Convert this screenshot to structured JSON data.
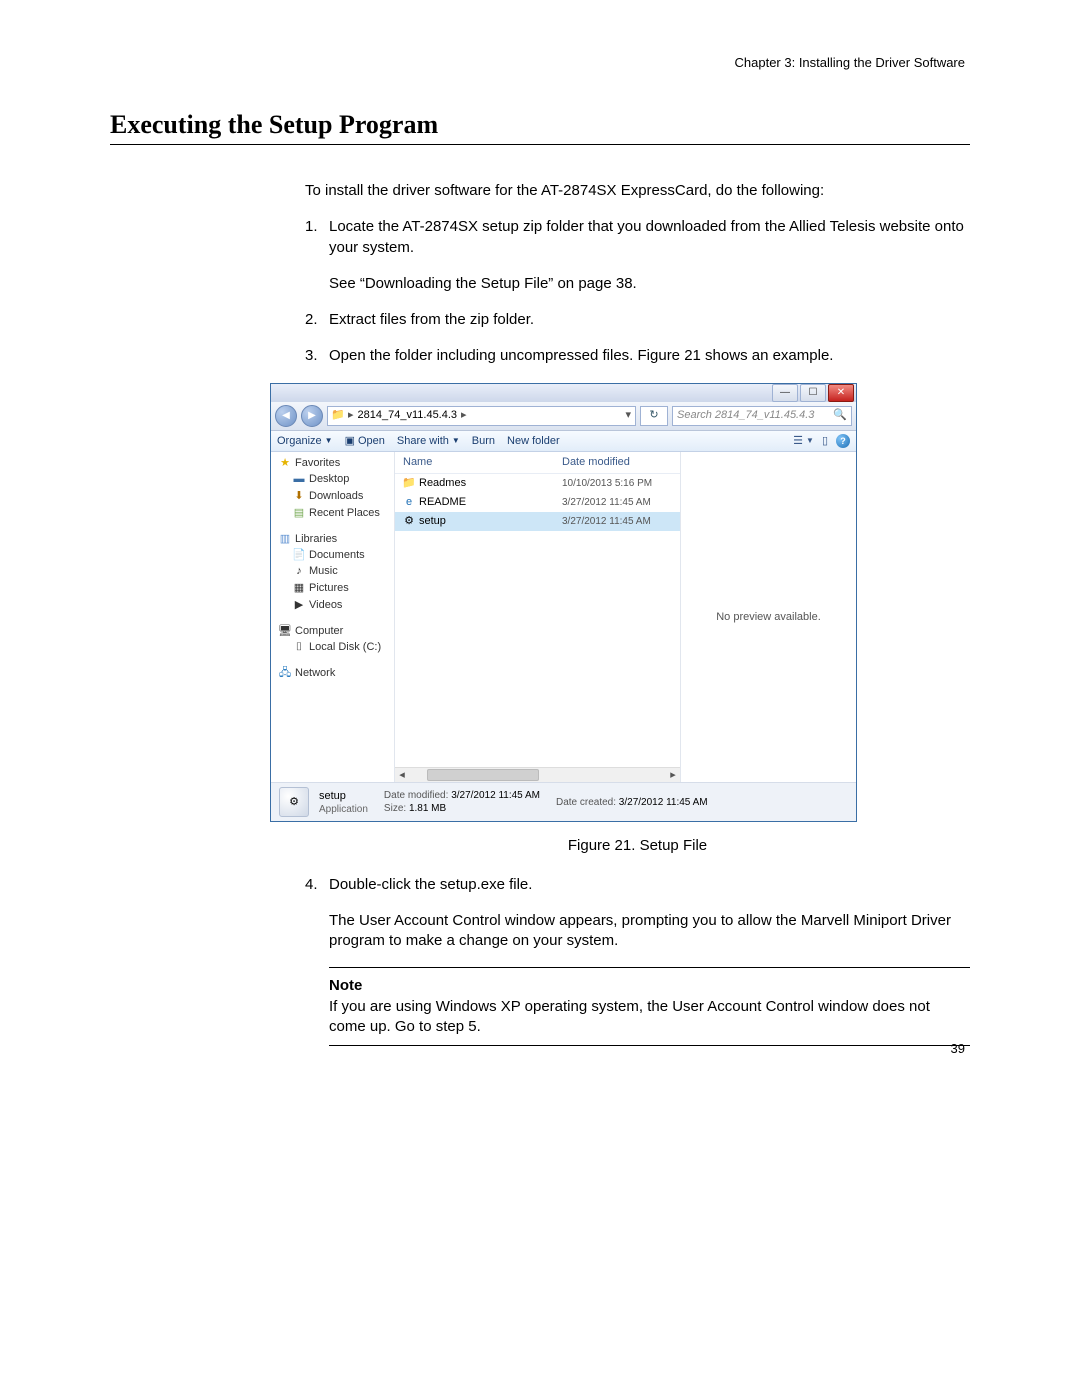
{
  "chapter": "Chapter 3: Installing the Driver Software",
  "heading": "Executing the Setup Program",
  "intro": "To install the driver software for the AT-2874SX ExpressCard, do the following:",
  "steps": {
    "s1_num": "1.",
    "s1_txt": "Locate the AT-2874SX setup zip folder that you downloaded from the Allied Telesis website onto your system.",
    "s1_sub": "See “Downloading the Setup File” on page 38.",
    "s2_num": "2.",
    "s2_txt": "Extract files from the zip folder.",
    "s3_num": "3.",
    "s3_txt": "Open the folder including uncompressed files. Figure 21 shows an example.",
    "s4_num": "4.",
    "s4_txt": "Double-click the setup.exe file.",
    "s4_sub": "The User Account Control window appears, prompting you to allow the Marvell Miniport Driver program to make a change on your system."
  },
  "figure_caption": "Figure 21. Setup File",
  "note": {
    "title": "Note",
    "body": "If you are using Windows XP operating system, the User Account Control window does not come up. Go to step 5."
  },
  "page_number": "39",
  "explorer": {
    "address_folder": "2814_74_v11.45.4.3",
    "search_placeholder": "Search 2814_74_v11.45.4.3",
    "toolbar": {
      "organize": "Organize",
      "open": "Open",
      "share": "Share with",
      "burn": "Burn",
      "newfolder": "New folder"
    },
    "nav": {
      "favorites": "Favorites",
      "desktop": "Desktop",
      "downloads": "Downloads",
      "recent": "Recent Places",
      "libraries": "Libraries",
      "documents": "Documents",
      "music": "Music",
      "pictures": "Pictures",
      "videos": "Videos",
      "computer": "Computer",
      "localdisk": "Local Disk (C:)",
      "network": "Network"
    },
    "columns": {
      "name": "Name",
      "date": "Date modified"
    },
    "files": [
      {
        "name": "Readmes",
        "date": "10/10/2013 5:16 PM",
        "icon": "folder"
      },
      {
        "name": "README",
        "date": "3/27/2012 11:45 AM",
        "icon": "ie"
      },
      {
        "name": "setup",
        "date": "3/27/2012 11:45 AM",
        "icon": "exe",
        "selected": true
      }
    ],
    "preview_text": "No preview available.",
    "status": {
      "name": "setup",
      "type": "Application",
      "mod_label": "Date modified:",
      "mod_value": "3/27/2012 11:45 AM",
      "size_label": "Size:",
      "size_value": "1.81 MB",
      "created_label": "Date created:",
      "created_value": "3/27/2012 11:45 AM"
    }
  }
}
